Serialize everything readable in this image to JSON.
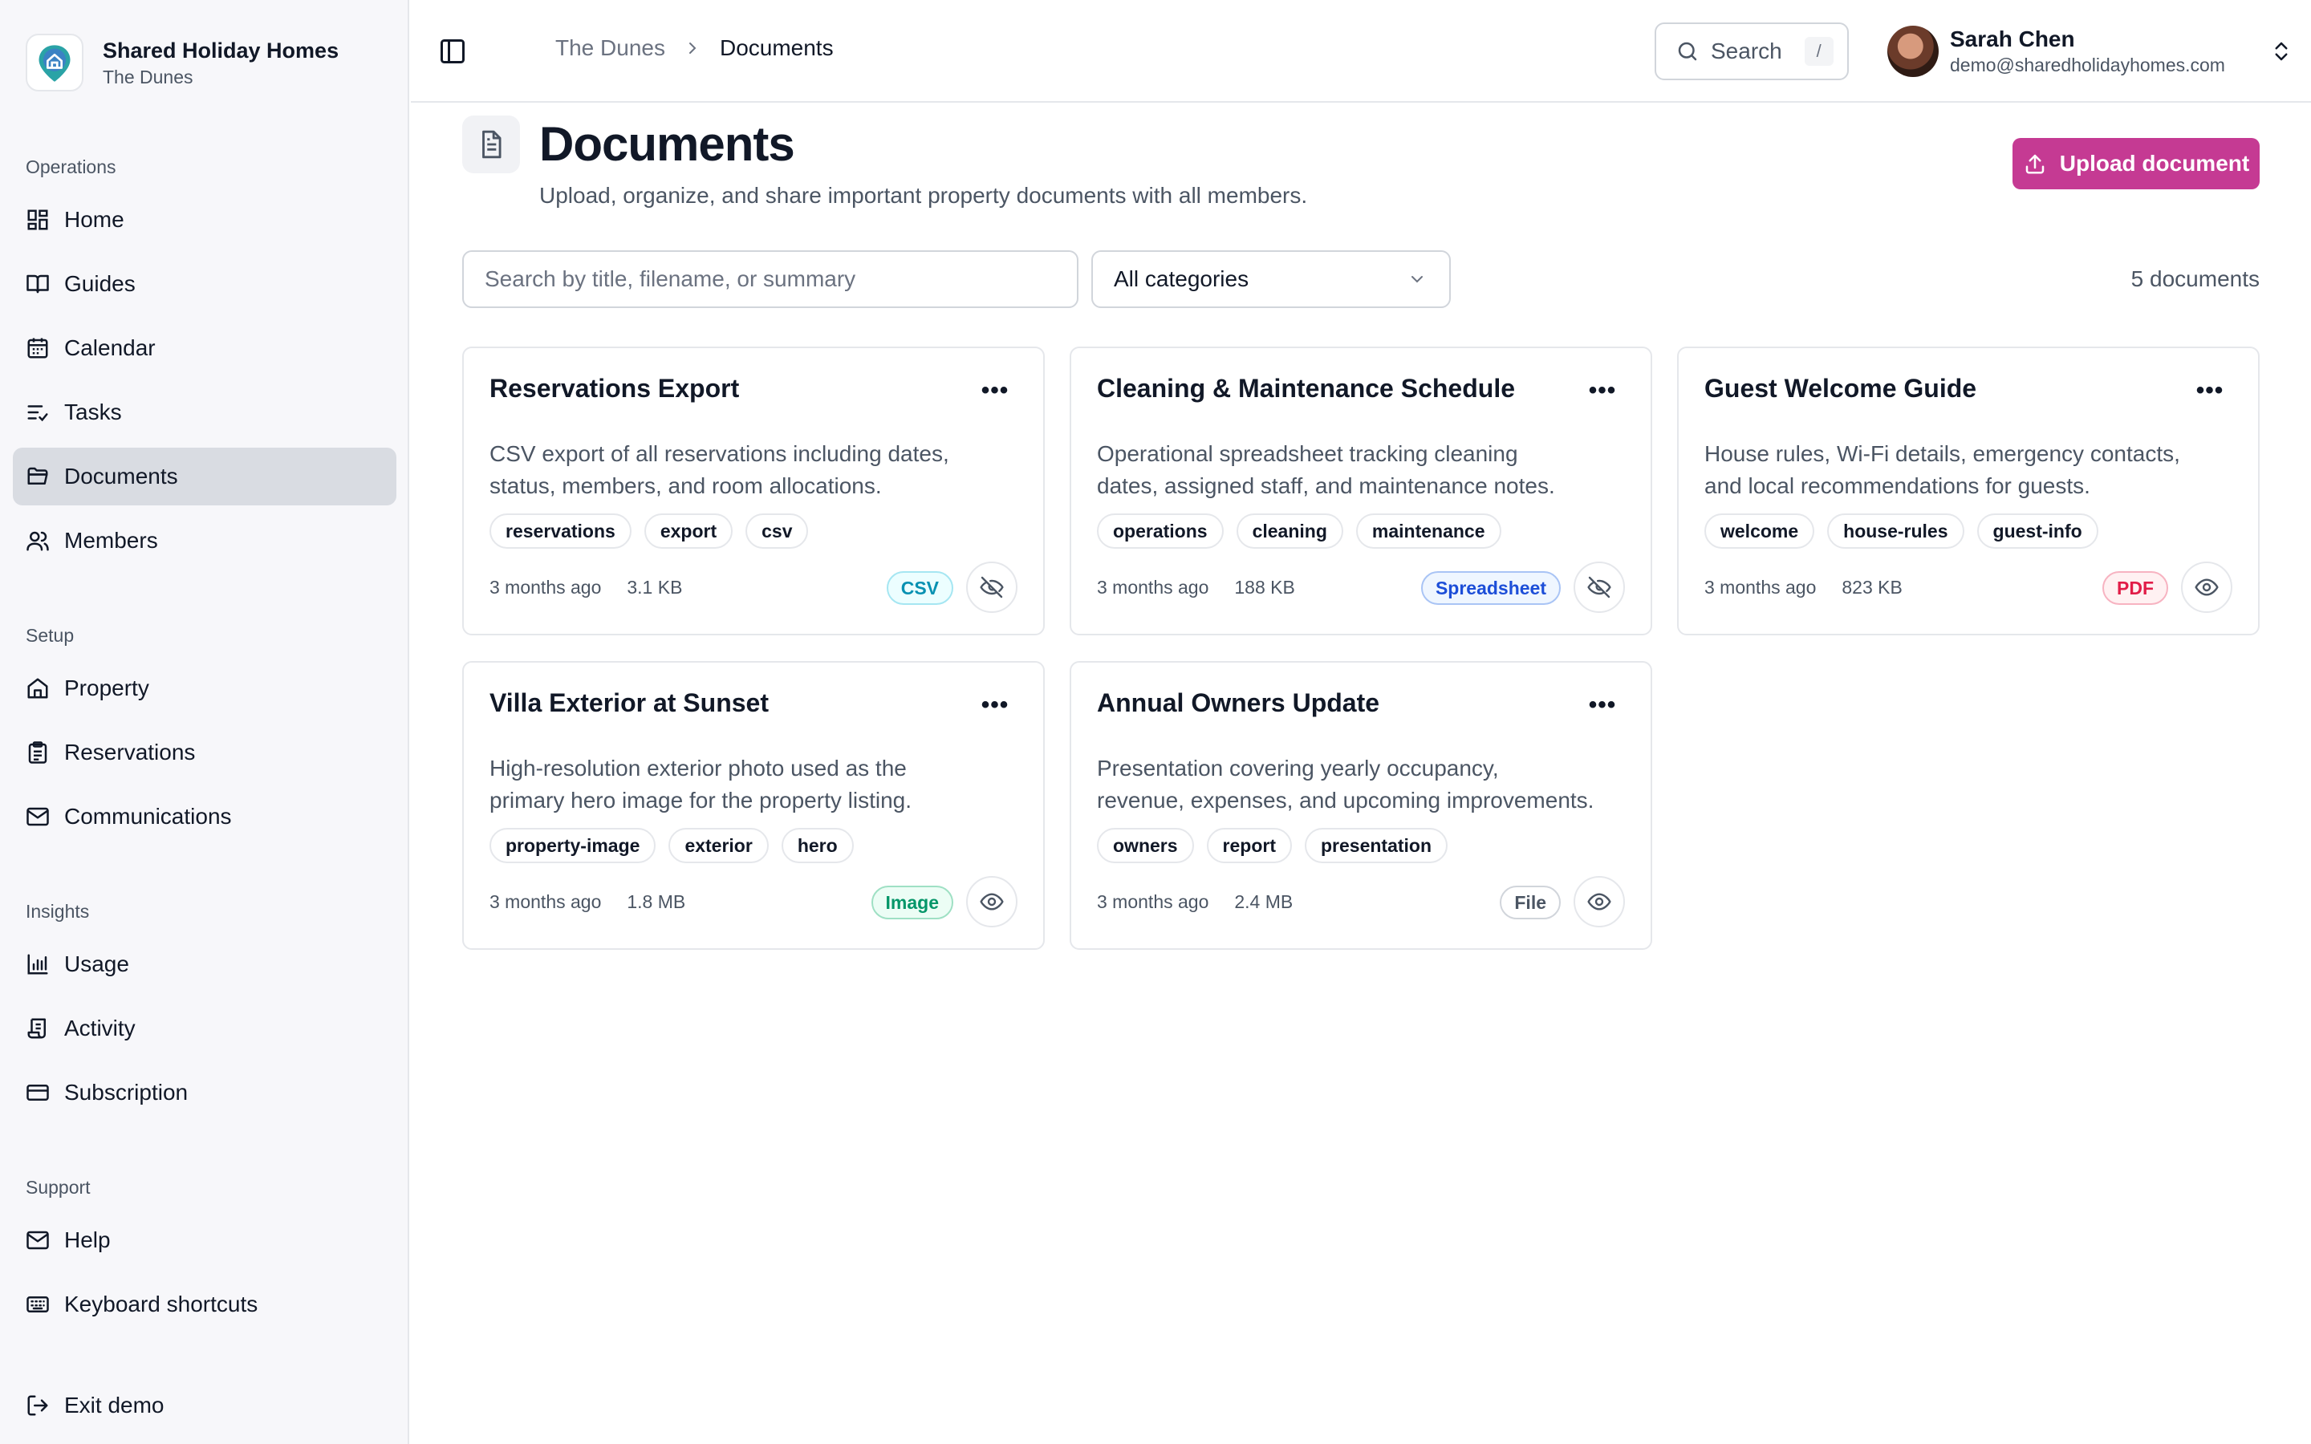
{
  "sidebar": {
    "brand_title": "Shared Holiday Homes",
    "brand_subtitle": "The Dunes",
    "groups": [
      {
        "heading": "Operations",
        "items": [
          {
            "label": "Home",
            "icon": "dashboard-icon"
          },
          {
            "label": "Guides",
            "icon": "book-icon"
          },
          {
            "label": "Calendar",
            "icon": "calendar-icon"
          },
          {
            "label": "Tasks",
            "icon": "task-list-icon"
          },
          {
            "label": "Documents",
            "icon": "folder-icon",
            "active": true
          },
          {
            "label": "Members",
            "icon": "users-icon"
          }
        ]
      },
      {
        "heading": "Setup",
        "items": [
          {
            "label": "Property",
            "icon": "house-icon"
          },
          {
            "label": "Reservations",
            "icon": "clipboard-icon"
          },
          {
            "label": "Communications",
            "icon": "mail-icon"
          }
        ]
      },
      {
        "heading": "Insights",
        "items": [
          {
            "label": "Usage",
            "icon": "bar-chart-icon"
          },
          {
            "label": "Activity",
            "icon": "scroll-icon"
          },
          {
            "label": "Subscription",
            "icon": "credit-card-icon"
          }
        ]
      },
      {
        "heading": "Support",
        "items": [
          {
            "label": "Help",
            "icon": "mail-icon"
          },
          {
            "label": "Keyboard shortcuts",
            "icon": "keyboard-icon"
          }
        ]
      }
    ],
    "exit_label": "Exit demo"
  },
  "topbar": {
    "breadcrumb": [
      "The Dunes",
      "Documents"
    ],
    "search_label": "Search",
    "search_shortcut": "/",
    "user_name": "Sarah Chen",
    "user_email": "demo@sharedholidayhomes.com"
  },
  "main": {
    "title": "Documents",
    "subtitle": "Upload, organize, and share important property documents with all members.",
    "upload_label": "Upload document",
    "search_placeholder": "Search by title, filename, or summary",
    "category_selected": "All categories",
    "doc_count": "5 documents"
  },
  "documents": [
    {
      "title": "Reservations Export",
      "desc_lines": [
        "CSV export of all reservations including dates,",
        "status, members, and room allocations."
      ],
      "tags": [
        "reservations",
        "export",
        "csv"
      ],
      "age": "3 months ago",
      "size": "3.1 KB",
      "type": "CSV",
      "type_color": "#0891b2",
      "type_bg": "#ecfeff",
      "type_border": "#a5e6f2",
      "visibility": "hidden"
    },
    {
      "title": "Cleaning & Maintenance Schedule",
      "desc_lines": [
        "Operational spreadsheet tracking cleaning",
        "dates, assigned staff, and maintenance notes."
      ],
      "tags": [
        "operations",
        "cleaning",
        "maintenance"
      ],
      "age": "3 months ago",
      "size": "188 KB",
      "type": "Spreadsheet",
      "type_color": "#1d4ed8",
      "type_bg": "#eff6ff",
      "type_border": "#a9c4f5",
      "visibility": "hidden"
    },
    {
      "title": "Guest Welcome Guide",
      "desc_lines": [
        "House rules, Wi-Fi details, emergency contacts,",
        "and local recommendations for guests."
      ],
      "tags": [
        "welcome",
        "house-rules",
        "guest-info"
      ],
      "age": "3 months ago",
      "size": "823 KB",
      "type": "PDF",
      "type_color": "#e11d48",
      "type_bg": "#fff1f2",
      "type_border": "#f7b3c1",
      "visibility": "visible"
    },
    {
      "title": "Villa Exterior at Sunset",
      "desc_lines": [
        "High-resolution exterior photo used as the",
        "primary hero image for the property listing."
      ],
      "tags": [
        "property-image",
        "exterior",
        "hero"
      ],
      "age": "3 months ago",
      "size": "1.8 MB",
      "type": "Image",
      "type_color": "#059669",
      "type_bg": "#ecfdf5",
      "type_border": "#9fe0c4",
      "visibility": "visible"
    },
    {
      "title": "Annual Owners Update",
      "desc_lines": [
        "Presentation covering yearly occupancy,",
        "revenue, expenses, and upcoming improvements."
      ],
      "tags": [
        "owners",
        "report",
        "presentation"
      ],
      "age": "3 months ago",
      "size": "2.4 MB",
      "type": "File",
      "type_color": "#4b5563",
      "type_bg": "#ffffff",
      "type_border": "#d1d5db",
      "visibility": "visible"
    }
  ],
  "colors": {
    "accent": "#c53a93",
    "active_nav": "#d9dce2"
  }
}
